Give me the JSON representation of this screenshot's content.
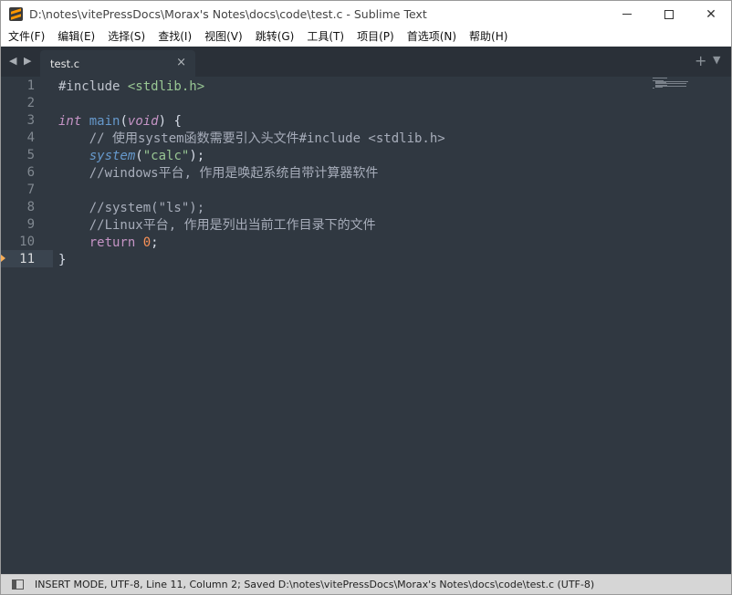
{
  "window": {
    "title": "D:\\notes\\vitePressDocs\\Morax's Notes\\docs\\code\\test.c - Sublime Text",
    "controls": {
      "minimize": "—",
      "maximize": "☐",
      "close": "✕"
    }
  },
  "menu": [
    "文件(F)",
    "编辑(E)",
    "选择(S)",
    "查找(I)",
    "视图(V)",
    "跳转(G)",
    "工具(T)",
    "项目(P)",
    "首选项(N)",
    "帮助(H)"
  ],
  "tabs": {
    "nav": "◀ ▶",
    "active": {
      "label": "test.c",
      "close": "×"
    },
    "new_tab": "+",
    "menu": "▼"
  },
  "editor": {
    "current_line": 11,
    "lines": [
      {
        "num": "1",
        "tokens": [
          {
            "t": "#include ",
            "c": "pp"
          },
          {
            "t": "<stdlib.h>",
            "c": "hdr"
          }
        ]
      },
      {
        "num": "2",
        "tokens": []
      },
      {
        "num": "3",
        "tokens": [
          {
            "t": "int",
            "c": "kw"
          },
          {
            "t": " ",
            "c": "punc"
          },
          {
            "t": "main",
            "c": "fn"
          },
          {
            "t": "(",
            "c": "punc"
          },
          {
            "t": "void",
            "c": "kw"
          },
          {
            "t": ") {",
            "c": "punc"
          }
        ]
      },
      {
        "num": "4",
        "tokens": [
          {
            "t": "    // 使用system函数需要引入头文件#include <stdlib.h>",
            "c": "cm"
          }
        ]
      },
      {
        "num": "5",
        "tokens": [
          {
            "t": "    ",
            "c": "punc"
          },
          {
            "t": "system",
            "c": "fnc"
          },
          {
            "t": "(",
            "c": "punc"
          },
          {
            "t": "\"calc\"",
            "c": "str"
          },
          {
            "t": ");",
            "c": "punc"
          }
        ]
      },
      {
        "num": "6",
        "tokens": [
          {
            "t": "    //windows平台, 作用是唤起系统自带计算器软件",
            "c": "cm"
          }
        ]
      },
      {
        "num": "7",
        "tokens": []
      },
      {
        "num": "8",
        "tokens": [
          {
            "t": "    //system(\"ls\");",
            "c": "cm"
          }
        ]
      },
      {
        "num": "9",
        "tokens": [
          {
            "t": "    //Linux平台, 作用是列出当前工作目录下的文件",
            "c": "cm"
          }
        ]
      },
      {
        "num": "10",
        "tokens": [
          {
            "t": "    ",
            "c": "punc"
          },
          {
            "t": "return",
            "c": "ret"
          },
          {
            "t": " ",
            "c": "punc"
          },
          {
            "t": "0",
            "c": "num"
          },
          {
            "t": ";",
            "c": "punc"
          }
        ]
      },
      {
        "num": "11",
        "tokens": [
          {
            "t": "}",
            "c": "punc"
          }
        ]
      }
    ]
  },
  "statusbar": {
    "text": "INSERT MODE, UTF-8, Line 11, Column 2; Saved D:\\notes\\vitePressDocs\\Morax's Notes\\docs\\code\\test.c (UTF-8)"
  },
  "colors": {
    "editor_bg": "#303841",
    "tabbar_bg": "#2a3038",
    "statusbar_bg": "#d6d6d6",
    "caret_marker": "#f9ae58"
  }
}
